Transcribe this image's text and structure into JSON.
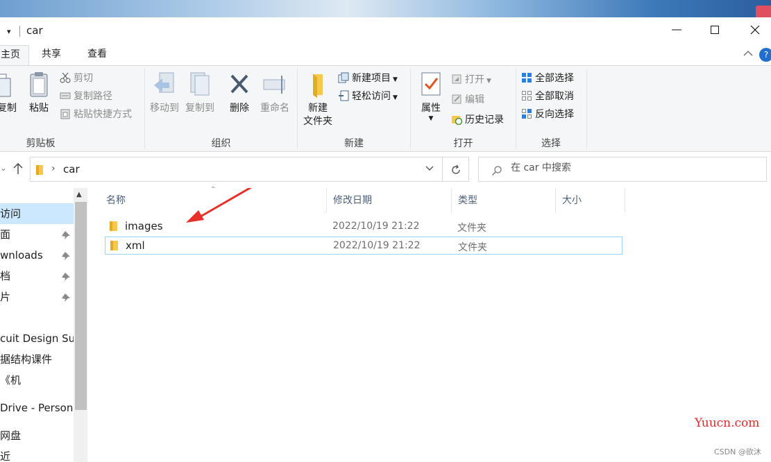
{
  "window": {
    "title": "car",
    "quick_access_arrow": "▾"
  },
  "ribbon_tabs": [
    "主页",
    "共享",
    "查看"
  ],
  "help_icon_text": "?",
  "ribbon": {
    "clipboard": {
      "copy": "复制",
      "paste": "粘贴",
      "cut": "剪切",
      "copy_path": "复制路径",
      "paste_shortcut": "粘贴快捷方式",
      "group_label": "剪贴板"
    },
    "organize": {
      "move_to": "移动到",
      "copy_to": "复制到",
      "delete": "删除",
      "rename": "重命名",
      "group_label": "组织"
    },
    "new": {
      "new_folder_line1": "新建",
      "new_folder_line2": "文件夹",
      "new_item": "新建项目",
      "easy_access": "轻松访问",
      "group_label": "新建"
    },
    "open": {
      "properties": "属性",
      "open": "打开",
      "edit": "编辑",
      "history": "历史记录",
      "group_label": "打开"
    },
    "select": {
      "select_all": "全部选择",
      "select_none": "全部取消",
      "invert": "反向选择",
      "group_label": "选择"
    }
  },
  "address": {
    "path": "car",
    "search_placeholder": "在 car 中搜索"
  },
  "nav_pane": {
    "items": [
      {
        "label": "访问",
        "selected": true,
        "pinned": false
      },
      {
        "label": "面",
        "selected": false,
        "pinned": true
      },
      {
        "label": "wnloads",
        "selected": false,
        "pinned": true
      },
      {
        "label": "档",
        "selected": false,
        "pinned": true
      },
      {
        "label": "片",
        "selected": false,
        "pinned": true
      },
      {
        "label": "cuit Design Suit",
        "selected": false,
        "pinned": false
      },
      {
        "label": "据结构课件",
        "selected": false,
        "pinned": false
      },
      {
        "label": "《机",
        "selected": false,
        "pinned": false
      },
      {
        "label": "Drive - Personal",
        "selected": false,
        "pinned": false
      },
      {
        "label": "网盘",
        "selected": false,
        "pinned": false
      },
      {
        "label": "近",
        "selected": false,
        "pinned": false
      }
    ]
  },
  "file_list": {
    "columns": [
      "名称",
      "修改日期",
      "类型",
      "大小"
    ],
    "rows": [
      {
        "name": "images",
        "date": "2022/10/19 21:22",
        "type": "文件夹",
        "size": ""
      },
      {
        "name": "xml",
        "date": "2022/10/19 21:22",
        "type": "文件夹",
        "size": ""
      }
    ]
  },
  "watermarks": {
    "site": "Yuucn.com",
    "credit": "CSDN @欲沐"
  },
  "colors": {
    "accent": "#cce8ff",
    "folder": "#f7c94b",
    "annotation_arrow": "#e8302a",
    "watermark_red": "#e02b2b"
  }
}
